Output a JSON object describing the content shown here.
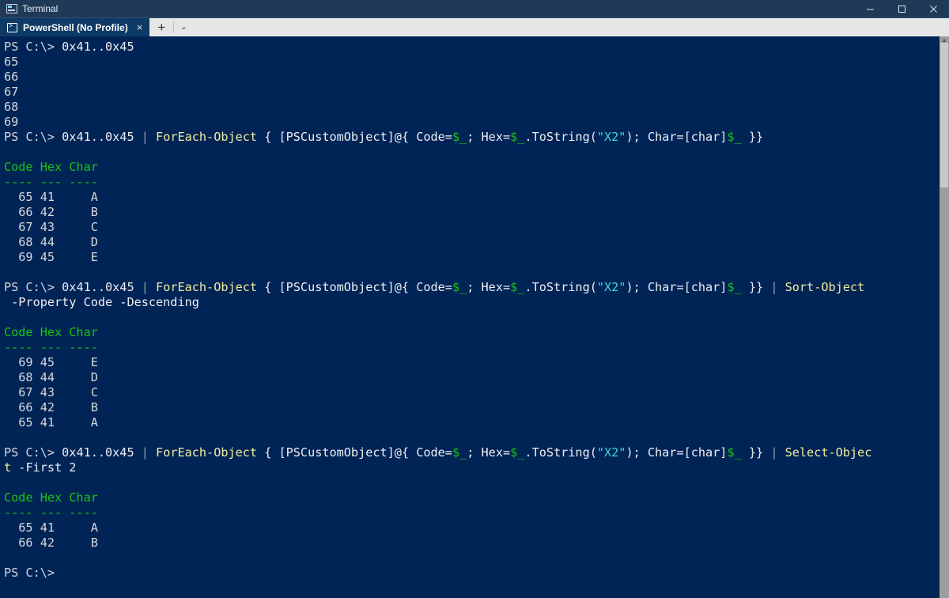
{
  "window": {
    "title": "Terminal",
    "app_icon": "terminal-icon",
    "controls": {
      "minimize": "minimize-icon",
      "maximize": "maximize-icon",
      "close": "close-icon"
    }
  },
  "tabbar": {
    "active_tab": {
      "label": "PowerShell (No Profile)",
      "icon": "powershell-icon",
      "close": "×"
    },
    "new_tab": "+",
    "dropdown": "⌄"
  },
  "terminal": {
    "prompt": "PS C:\\> ",
    "lines": [
      {
        "id": "cmd-1",
        "segments": [
          {
            "t": "PS C:\\> ",
            "c": "c-white"
          },
          {
            "t": "0x41..0x45",
            "c": "c-bright"
          }
        ]
      },
      {
        "id": "out-1-65",
        "segments": [
          {
            "t": "65",
            "c": "c-white"
          }
        ]
      },
      {
        "id": "out-1-66",
        "segments": [
          {
            "t": "66",
            "c": "c-white"
          }
        ]
      },
      {
        "id": "out-1-67",
        "segments": [
          {
            "t": "67",
            "c": "c-white"
          }
        ]
      },
      {
        "id": "out-1-68",
        "segments": [
          {
            "t": "68",
            "c": "c-white"
          }
        ]
      },
      {
        "id": "out-1-69",
        "segments": [
          {
            "t": "69",
            "c": "c-white"
          }
        ]
      },
      {
        "id": "cmd-2",
        "segments": [
          {
            "t": "PS C:\\> ",
            "c": "c-white"
          },
          {
            "t": "0x41..0x45 ",
            "c": "c-bright"
          },
          {
            "t": "| ",
            "c": "c-gray"
          },
          {
            "t": "ForEach-Object ",
            "c": "c-yellow"
          },
          {
            "t": "{ [PSCustomObject]@{ Code=",
            "c": "c-bright"
          },
          {
            "t": "$_",
            "c": "c-green"
          },
          {
            "t": "; Hex=",
            "c": "c-bright"
          },
          {
            "t": "$_",
            "c": "c-green"
          },
          {
            "t": ".ToString(",
            "c": "c-bright"
          },
          {
            "t": "\"X2\"",
            "c": "c-cyan"
          },
          {
            "t": "); Char=[char]",
            "c": "c-bright"
          },
          {
            "t": "$_",
            "c": "c-green"
          },
          {
            "t": " }}",
            "c": "c-bright"
          }
        ]
      },
      {
        "id": "blank-1",
        "segments": [
          {
            "t": "",
            "c": "c-white"
          }
        ]
      },
      {
        "id": "hdr-1",
        "segments": [
          {
            "t": "Code Hex Char",
            "c": "c-hdrgreen"
          }
        ]
      },
      {
        "id": "rule-1",
        "segments": [
          {
            "t": "---- --- ----",
            "c": "c-hdrgreen"
          }
        ]
      },
      {
        "id": "row-1-1",
        "segments": [
          {
            "t": "  65 41     A",
            "c": "c-white"
          }
        ]
      },
      {
        "id": "row-1-2",
        "segments": [
          {
            "t": "  66 42     B",
            "c": "c-white"
          }
        ]
      },
      {
        "id": "row-1-3",
        "segments": [
          {
            "t": "  67 43     C",
            "c": "c-white"
          }
        ]
      },
      {
        "id": "row-1-4",
        "segments": [
          {
            "t": "  68 44     D",
            "c": "c-white"
          }
        ]
      },
      {
        "id": "row-1-5",
        "segments": [
          {
            "t": "  69 45     E",
            "c": "c-white"
          }
        ]
      },
      {
        "id": "blank-2",
        "segments": [
          {
            "t": "",
            "c": "c-white"
          }
        ]
      },
      {
        "id": "cmd-3",
        "segments": [
          {
            "t": "PS C:\\> ",
            "c": "c-white"
          },
          {
            "t": "0x41..0x45 ",
            "c": "c-bright"
          },
          {
            "t": "| ",
            "c": "c-gray"
          },
          {
            "t": "ForEach-Object ",
            "c": "c-yellow"
          },
          {
            "t": "{ [PSCustomObject]@{ Code=",
            "c": "c-bright"
          },
          {
            "t": "$_",
            "c": "c-green"
          },
          {
            "t": "; Hex=",
            "c": "c-bright"
          },
          {
            "t": "$_",
            "c": "c-green"
          },
          {
            "t": ".ToString(",
            "c": "c-bright"
          },
          {
            "t": "\"X2\"",
            "c": "c-cyan"
          },
          {
            "t": "); Char=[char]",
            "c": "c-bright"
          },
          {
            "t": "$_",
            "c": "c-green"
          },
          {
            "t": " }} ",
            "c": "c-bright"
          },
          {
            "t": "| ",
            "c": "c-gray"
          },
          {
            "t": "Sort-Object",
            "c": "c-yellow"
          }
        ]
      },
      {
        "id": "cmd-3-wrap",
        "segments": [
          {
            "t": " -Property Code -Descending",
            "c": "c-bright"
          }
        ]
      },
      {
        "id": "blank-3",
        "segments": [
          {
            "t": "",
            "c": "c-white"
          }
        ]
      },
      {
        "id": "hdr-2",
        "segments": [
          {
            "t": "Code Hex Char",
            "c": "c-hdrgreen"
          }
        ]
      },
      {
        "id": "rule-2",
        "segments": [
          {
            "t": "---- --- ----",
            "c": "c-hdrgreen"
          }
        ]
      },
      {
        "id": "row-2-1",
        "segments": [
          {
            "t": "  69 45     E",
            "c": "c-white"
          }
        ]
      },
      {
        "id": "row-2-2",
        "segments": [
          {
            "t": "  68 44     D",
            "c": "c-white"
          }
        ]
      },
      {
        "id": "row-2-3",
        "segments": [
          {
            "t": "  67 43     C",
            "c": "c-white"
          }
        ]
      },
      {
        "id": "row-2-4",
        "segments": [
          {
            "t": "  66 42     B",
            "c": "c-white"
          }
        ]
      },
      {
        "id": "row-2-5",
        "segments": [
          {
            "t": "  65 41     A",
            "c": "c-white"
          }
        ]
      },
      {
        "id": "blank-4",
        "segments": [
          {
            "t": "",
            "c": "c-white"
          }
        ]
      },
      {
        "id": "cmd-4",
        "segments": [
          {
            "t": "PS C:\\> ",
            "c": "c-white"
          },
          {
            "t": "0x41..0x45 ",
            "c": "c-bright"
          },
          {
            "t": "| ",
            "c": "c-gray"
          },
          {
            "t": "ForEach-Object ",
            "c": "c-yellow"
          },
          {
            "t": "{ [PSCustomObject]@{ Code=",
            "c": "c-bright"
          },
          {
            "t": "$_",
            "c": "c-green"
          },
          {
            "t": "; Hex=",
            "c": "c-bright"
          },
          {
            "t": "$_",
            "c": "c-green"
          },
          {
            "t": ".ToString(",
            "c": "c-bright"
          },
          {
            "t": "\"X2\"",
            "c": "c-cyan"
          },
          {
            "t": "); Char=[char]",
            "c": "c-bright"
          },
          {
            "t": "$_",
            "c": "c-green"
          },
          {
            "t": " }} ",
            "c": "c-bright"
          },
          {
            "t": "| ",
            "c": "c-gray"
          },
          {
            "t": "Select-Objec",
            "c": "c-yellow"
          }
        ]
      },
      {
        "id": "cmd-4-wrap",
        "segments": [
          {
            "t": "t",
            "c": "c-yellow"
          },
          {
            "t": " -First 2",
            "c": "c-bright"
          }
        ]
      },
      {
        "id": "blank-5",
        "segments": [
          {
            "t": "",
            "c": "c-white"
          }
        ]
      },
      {
        "id": "hdr-3",
        "segments": [
          {
            "t": "Code Hex Char",
            "c": "c-hdrgreen"
          }
        ]
      },
      {
        "id": "rule-3",
        "segments": [
          {
            "t": "---- --- ----",
            "c": "c-hdrgreen"
          }
        ]
      },
      {
        "id": "row-3-1",
        "segments": [
          {
            "t": "  65 41     A",
            "c": "c-white"
          }
        ]
      },
      {
        "id": "row-3-2",
        "segments": [
          {
            "t": "  66 42     B",
            "c": "c-white"
          }
        ]
      },
      {
        "id": "blank-6",
        "segments": [
          {
            "t": "",
            "c": "c-white"
          }
        ]
      },
      {
        "id": "prompt-final",
        "segments": [
          {
            "t": "PS C:\\>",
            "c": "c-white"
          }
        ]
      }
    ]
  },
  "scrollbar": {
    "up_arrow": "▲",
    "down_arrow": "▼"
  },
  "colors": {
    "background": "#012456",
    "titlebar": "#1f3a57",
    "tabstrip": "#e6e6e6",
    "tab_active": "#0e3a66",
    "cmdlet": "#eeeda1",
    "variable": "#16c60c",
    "string": "#3fd8e0",
    "header": "#16c60c",
    "text": "#d6d7da"
  }
}
